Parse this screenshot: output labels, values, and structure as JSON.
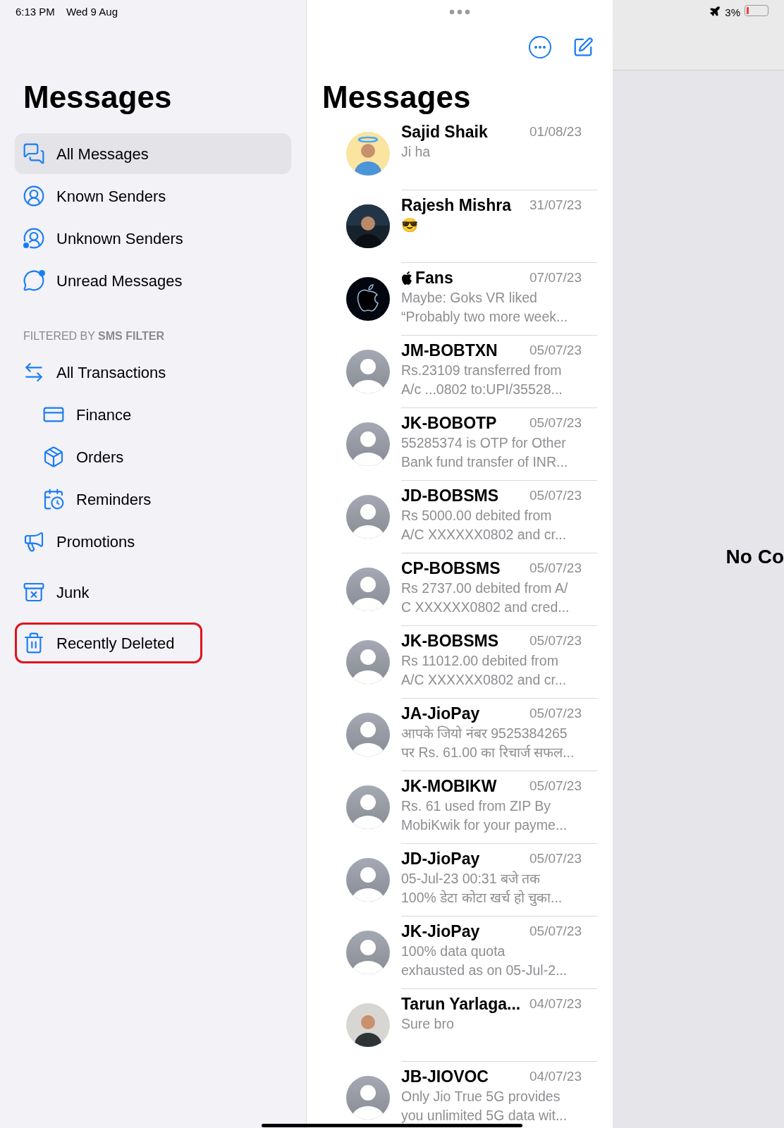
{
  "status_bar": {
    "time": "6:13 PM",
    "date": "Wed 9 Aug",
    "battery": "3%"
  },
  "sidebar": {
    "title": "Messages",
    "items": [
      {
        "label": "All Messages",
        "kind": "messages",
        "selected": true,
        "highlighted": false
      },
      {
        "label": "Known Senders",
        "kind": "known",
        "selected": false,
        "highlighted": false
      },
      {
        "label": "Unknown Senders",
        "kind": "unknown",
        "selected": false,
        "highlighted": false
      },
      {
        "label": "Unread Messages",
        "kind": "unread",
        "selected": false,
        "highlighted": false
      }
    ],
    "filter_header": {
      "prefix": "FILTERED BY ",
      "bold": "SMS FILTER"
    },
    "filter_items": [
      {
        "label": "All Transactions",
        "kind": "transactions",
        "selected": false,
        "highlighted": false,
        "children": [
          {
            "label": "Finance",
            "kind": "finance",
            "selected": false,
            "highlighted": false
          },
          {
            "label": "Orders",
            "kind": "orders",
            "selected": false,
            "highlighted": false
          },
          {
            "label": "Reminders",
            "kind": "reminders",
            "selected": false,
            "highlighted": false
          }
        ]
      },
      {
        "label": "Promotions",
        "kind": "promotions",
        "selected": false,
        "highlighted": false
      }
    ],
    "bottom_items": [
      {
        "label": "Junk",
        "kind": "junk",
        "selected": false,
        "highlighted": false
      },
      {
        "label": "Recently Deleted",
        "kind": "trash",
        "selected": false,
        "highlighted": true
      }
    ]
  },
  "list": {
    "title": "Messages",
    "conversations": [
      {
        "name": "Sajid Shaik",
        "date": "01/08/23",
        "preview": [
          "Ji ha"
        ],
        "kind": "memoji"
      },
      {
        "name": "Rajesh Mishra",
        "date": "31/07/23",
        "preview": [
          "😎"
        ]
      },
      {
        "name": "Fans",
        "date": "07/07/23",
        "preview": [
          "Maybe: Goks VR liked",
          "“Probably two more week..."
        ],
        "kind": "logo"
      },
      {
        "name": "JM-BOBTXN",
        "date": "05/07/23",
        "preview": [
          "Rs.23109 transferred from",
          "A/c ...0802 to:UPI/35528..."
        ],
        "kind": "default"
      },
      {
        "name": "JK-BOBOTP",
        "date": "05/07/23",
        "preview": [
          "55285374 is OTP for Other",
          "Bank fund transfer of INR..."
        ],
        "kind": "default"
      },
      {
        "name": "JD-BOBSMS",
        "date": "05/07/23",
        "preview": [
          "Rs 5000.00 debited from",
          "A/C XXXXXX0802 and cr..."
        ],
        "kind": "default"
      },
      {
        "name": "CP-BOBSMS",
        "date": "05/07/23",
        "preview": [
          "Rs 2737.00 debited from A/",
          "C XXXXXX0802 and cred..."
        ],
        "kind": "default"
      },
      {
        "name": "JK-BOBSMS",
        "date": "05/07/23",
        "preview": [
          "Rs 11012.00 debited from",
          "A/C XXXXXX0802 and cr..."
        ],
        "kind": "default"
      },
      {
        "name": "JA-JioPay",
        "date": "05/07/23",
        "preview": [
          "आपके जियो नंबर 9525384265",
          "पर Rs. 61.00 का रिचार्ज सफल..."
        ],
        "kind": "default"
      },
      {
        "name": "JK-MOBIKW",
        "date": "05/07/23",
        "preview": [
          "Rs. 61 used from ZIP By",
          "MobiKwik for your payme..."
        ],
        "kind": "default"
      },
      {
        "name": "JD-JioPay",
        "date": "05/07/23",
        "preview": [
          "05-Jul-23 00:31 बजे तक",
          "100% डेटा कोटा खर्च हो चुका..."
        ],
        "kind": "default"
      },
      {
        "name": "JK-JioPay",
        "date": "05/07/23",
        "preview": [
          "100% data quota",
          "exhausted as on 05-Jul-2..."
        ],
        "kind": "default"
      },
      {
        "name": "Tarun Yarlaga...",
        "date": "04/07/23",
        "preview": [
          "Sure bro"
        ],
        "kind": "photo_light"
      },
      {
        "name": "JB-JIOVOC",
        "date": "04/07/23",
        "preview": [
          "Only Jio True 5G provides",
          "you unlimited 5G data wit..."
        ],
        "kind": "default"
      }
    ]
  },
  "detail": {
    "placeholder_text": "No Co"
  }
}
